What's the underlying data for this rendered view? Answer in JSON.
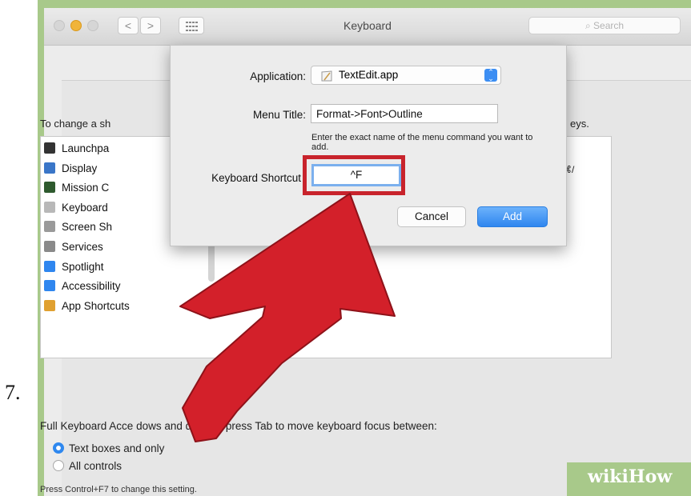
{
  "step_number": "7.",
  "window": {
    "title": "Keyboard",
    "search_placeholder": "Search",
    "nav_back": "<",
    "nav_forward": ">"
  },
  "background": {
    "intro_text": "To change a sh",
    "intro_text_end": "eys.",
    "sidebar_items": [
      {
        "label": "Launchpa",
        "icon": "launchpad-icon",
        "color": "#333333"
      },
      {
        "label": "Display",
        "icon": "display-icon",
        "color": "#3a76c8"
      },
      {
        "label": "Mission C",
        "icon": "mission-control-icon",
        "color": "#2e5a2e"
      },
      {
        "label": "Keyboard",
        "icon": "keyboard-icon",
        "color": "#b8b8b8"
      },
      {
        "label": "Screen Sh",
        "icon": "screenshot-icon",
        "color": "#9a9a9a"
      },
      {
        "label": "Services",
        "icon": "gear-icon",
        "color": "#8a8a8a"
      },
      {
        "label": "Spotlight",
        "icon": "spotlight-icon",
        "color": "#2f86ef"
      },
      {
        "label": "Accessibility",
        "icon": "accessibility-icon",
        "color": "#2f86ef"
      },
      {
        "label": "App Shortcuts",
        "icon": "app-shortcuts-icon",
        "color": "#e0a030"
      }
    ],
    "shortcut_glyph": "⇧⌘/",
    "full_keyboard_text": "Full Keyboard Acce             dows and dialogs, press Tab to move keyboard focus between:",
    "radio_options": [
      {
        "label": "Text boxes and         only",
        "selected": true
      },
      {
        "label": "All controls",
        "selected": false
      }
    ],
    "press_text": "Press Control+F7 to change this setting."
  },
  "dialog": {
    "application_label": "Application:",
    "application_value": "TextEdit.app",
    "menu_title_label": "Menu Title:",
    "menu_title_value": "Format->Font>Outline",
    "hint": "Enter the exact name of the menu command you want to add.",
    "shortcut_label": "Keyboard Shortcut",
    "shortcut_value": "^F",
    "cancel_label": "Cancel",
    "add_label": "Add"
  },
  "colors": {
    "accent": "#2f86ef",
    "arrow": "#d3202a",
    "highlight_box": "#c8232c",
    "frame": "#a8c98a"
  },
  "watermark": "wikiHow"
}
